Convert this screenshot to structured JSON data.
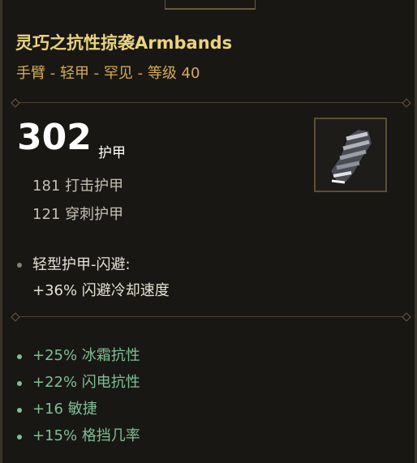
{
  "item": {
    "name": "灵巧之抗性掠袭Armbands",
    "subtitle": "手臂 - 轻甲 - 罕见 - 等级 40",
    "icon": "armband-icon"
  },
  "armor": {
    "value": "302",
    "label": "护甲",
    "lines": [
      "181 打击护甲",
      "121 穿刺护甲"
    ]
  },
  "perk": {
    "title": "轻型护甲-闪避:",
    "effect": "+36% 闪避冷却速度"
  },
  "bonuses": [
    "+25% 冰霜抗性",
    "+22% 闪电抗性",
    "+16 敏捷",
    "+15% 格挡几率"
  ],
  "colors": {
    "title": "#ead37c",
    "subtitle": "#d8ab53",
    "bonus": "#7fbf92"
  }
}
